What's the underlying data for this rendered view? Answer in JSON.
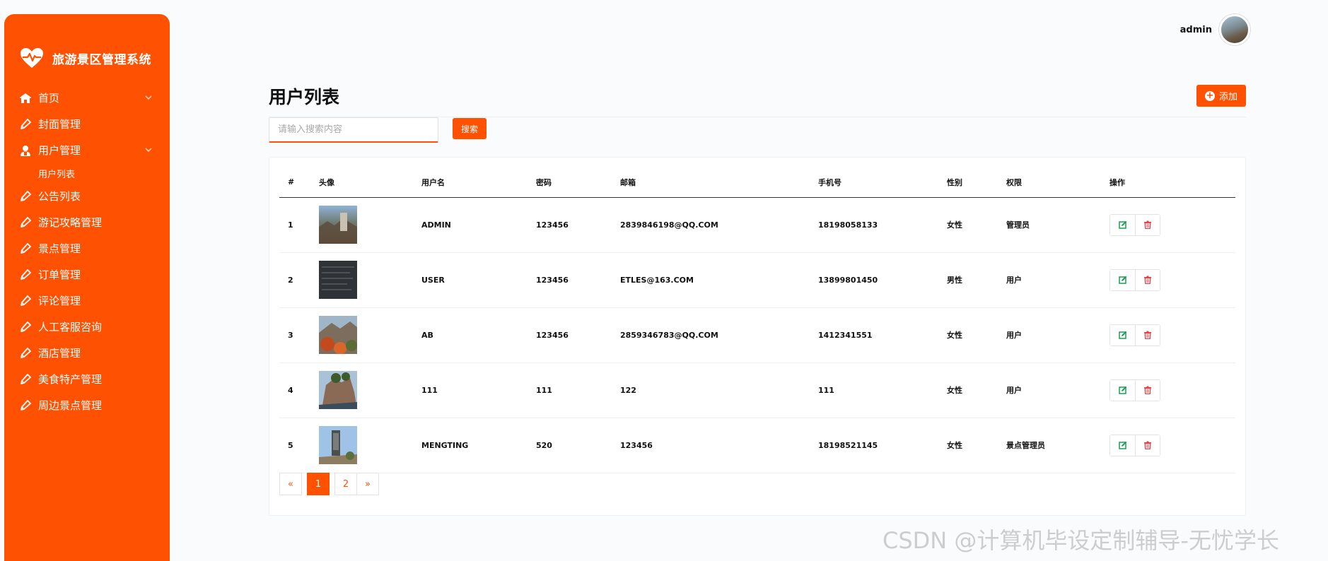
{
  "brand": {
    "title": "旅游景区管理系统",
    "icon": "heart-pulse-icon"
  },
  "sidebar": {
    "items": [
      {
        "label": "首页",
        "icon": "home-icon",
        "chevron": true
      },
      {
        "label": "封面管理",
        "icon": "pencil-icon"
      },
      {
        "label": "用户管理",
        "icon": "user-icon",
        "chevron": true
      },
      {
        "label": "用户列表",
        "sub": true
      },
      {
        "label": "公告列表",
        "icon": "pencil-icon"
      },
      {
        "label": "游记攻略管理",
        "icon": "pencil-icon"
      },
      {
        "label": "景点管理",
        "icon": "pencil-icon"
      },
      {
        "label": "订单管理",
        "icon": "pencil-icon"
      },
      {
        "label": "评论管理",
        "icon": "pencil-icon"
      },
      {
        "label": "人工客服咨询",
        "icon": "pencil-icon"
      },
      {
        "label": "酒店管理",
        "icon": "pencil-icon"
      },
      {
        "label": "美食特产管理",
        "icon": "pencil-icon"
      },
      {
        "label": "周边景点管理",
        "icon": "pencil-icon"
      }
    ]
  },
  "header": {
    "username": "admin"
  },
  "main": {
    "title": "用户列表",
    "add_label": "添加",
    "search_placeholder": "请输入搜索内容",
    "search_label": "搜索"
  },
  "table": {
    "headers": [
      "#",
      "头像",
      "用户名",
      "密码",
      "邮箱",
      "手机号",
      "性别",
      "权限",
      "操作"
    ],
    "rows": [
      {
        "id": "1",
        "username": "ADMIN",
        "password": "123456",
        "email": "2839846198@QQ.COM",
        "phone": "18198058133",
        "gender": "女性",
        "role": "管理员"
      },
      {
        "id": "2",
        "username": "USER",
        "password": "123456",
        "email": "ETLES@163.COM",
        "phone": "13899801450",
        "gender": "男性",
        "role": "用户"
      },
      {
        "id": "3",
        "username": "AB",
        "password": "123456",
        "email": "2859346783@QQ.COM",
        "phone": "1412341551",
        "gender": "女性",
        "role": "用户"
      },
      {
        "id": "4",
        "username": "111",
        "password": "111",
        "email": "122",
        "phone": "111",
        "gender": "女性",
        "role": "用户"
      },
      {
        "id": "5",
        "username": "MENGTING",
        "password": "520",
        "email": "123456",
        "phone": "18198521145",
        "gender": "女性",
        "role": "景点管理员"
      }
    ]
  },
  "pagination": {
    "prev": "«",
    "pages": [
      "1",
      "2"
    ],
    "next": "»",
    "current": "1"
  },
  "watermark": "CSDN @计算机毕设定制辅导-无忧学长",
  "colors": {
    "accent": "#ff5102",
    "edit": "#1a9e52",
    "delete": "#e0434a"
  }
}
